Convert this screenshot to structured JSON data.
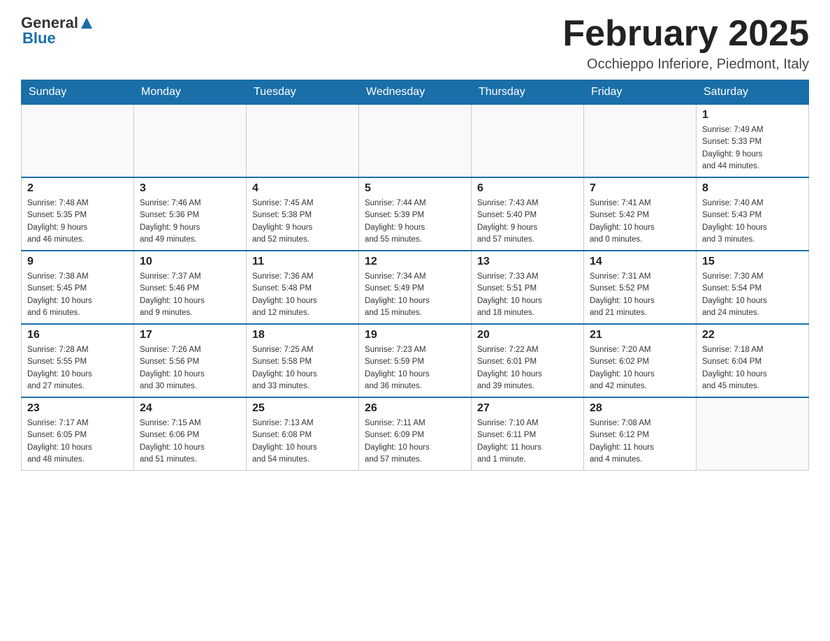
{
  "header": {
    "logo_general": "General",
    "logo_blue": "Blue",
    "month_title": "February 2025",
    "location": "Occhieppo Inferiore, Piedmont, Italy"
  },
  "days_of_week": [
    "Sunday",
    "Monday",
    "Tuesday",
    "Wednesday",
    "Thursday",
    "Friday",
    "Saturday"
  ],
  "weeks": [
    [
      {
        "day": "",
        "info": ""
      },
      {
        "day": "",
        "info": ""
      },
      {
        "day": "",
        "info": ""
      },
      {
        "day": "",
        "info": ""
      },
      {
        "day": "",
        "info": ""
      },
      {
        "day": "",
        "info": ""
      },
      {
        "day": "1",
        "info": "Sunrise: 7:49 AM\nSunset: 5:33 PM\nDaylight: 9 hours\nand 44 minutes."
      }
    ],
    [
      {
        "day": "2",
        "info": "Sunrise: 7:48 AM\nSunset: 5:35 PM\nDaylight: 9 hours\nand 46 minutes."
      },
      {
        "day": "3",
        "info": "Sunrise: 7:46 AM\nSunset: 5:36 PM\nDaylight: 9 hours\nand 49 minutes."
      },
      {
        "day": "4",
        "info": "Sunrise: 7:45 AM\nSunset: 5:38 PM\nDaylight: 9 hours\nand 52 minutes."
      },
      {
        "day": "5",
        "info": "Sunrise: 7:44 AM\nSunset: 5:39 PM\nDaylight: 9 hours\nand 55 minutes."
      },
      {
        "day": "6",
        "info": "Sunrise: 7:43 AM\nSunset: 5:40 PM\nDaylight: 9 hours\nand 57 minutes."
      },
      {
        "day": "7",
        "info": "Sunrise: 7:41 AM\nSunset: 5:42 PM\nDaylight: 10 hours\nand 0 minutes."
      },
      {
        "day": "8",
        "info": "Sunrise: 7:40 AM\nSunset: 5:43 PM\nDaylight: 10 hours\nand 3 minutes."
      }
    ],
    [
      {
        "day": "9",
        "info": "Sunrise: 7:38 AM\nSunset: 5:45 PM\nDaylight: 10 hours\nand 6 minutes."
      },
      {
        "day": "10",
        "info": "Sunrise: 7:37 AM\nSunset: 5:46 PM\nDaylight: 10 hours\nand 9 minutes."
      },
      {
        "day": "11",
        "info": "Sunrise: 7:36 AM\nSunset: 5:48 PM\nDaylight: 10 hours\nand 12 minutes."
      },
      {
        "day": "12",
        "info": "Sunrise: 7:34 AM\nSunset: 5:49 PM\nDaylight: 10 hours\nand 15 minutes."
      },
      {
        "day": "13",
        "info": "Sunrise: 7:33 AM\nSunset: 5:51 PM\nDaylight: 10 hours\nand 18 minutes."
      },
      {
        "day": "14",
        "info": "Sunrise: 7:31 AM\nSunset: 5:52 PM\nDaylight: 10 hours\nand 21 minutes."
      },
      {
        "day": "15",
        "info": "Sunrise: 7:30 AM\nSunset: 5:54 PM\nDaylight: 10 hours\nand 24 minutes."
      }
    ],
    [
      {
        "day": "16",
        "info": "Sunrise: 7:28 AM\nSunset: 5:55 PM\nDaylight: 10 hours\nand 27 minutes."
      },
      {
        "day": "17",
        "info": "Sunrise: 7:26 AM\nSunset: 5:56 PM\nDaylight: 10 hours\nand 30 minutes."
      },
      {
        "day": "18",
        "info": "Sunrise: 7:25 AM\nSunset: 5:58 PM\nDaylight: 10 hours\nand 33 minutes."
      },
      {
        "day": "19",
        "info": "Sunrise: 7:23 AM\nSunset: 5:59 PM\nDaylight: 10 hours\nand 36 minutes."
      },
      {
        "day": "20",
        "info": "Sunrise: 7:22 AM\nSunset: 6:01 PM\nDaylight: 10 hours\nand 39 minutes."
      },
      {
        "day": "21",
        "info": "Sunrise: 7:20 AM\nSunset: 6:02 PM\nDaylight: 10 hours\nand 42 minutes."
      },
      {
        "day": "22",
        "info": "Sunrise: 7:18 AM\nSunset: 6:04 PM\nDaylight: 10 hours\nand 45 minutes."
      }
    ],
    [
      {
        "day": "23",
        "info": "Sunrise: 7:17 AM\nSunset: 6:05 PM\nDaylight: 10 hours\nand 48 minutes."
      },
      {
        "day": "24",
        "info": "Sunrise: 7:15 AM\nSunset: 6:06 PM\nDaylight: 10 hours\nand 51 minutes."
      },
      {
        "day": "25",
        "info": "Sunrise: 7:13 AM\nSunset: 6:08 PM\nDaylight: 10 hours\nand 54 minutes."
      },
      {
        "day": "26",
        "info": "Sunrise: 7:11 AM\nSunset: 6:09 PM\nDaylight: 10 hours\nand 57 minutes."
      },
      {
        "day": "27",
        "info": "Sunrise: 7:10 AM\nSunset: 6:11 PM\nDaylight: 11 hours\nand 1 minute."
      },
      {
        "day": "28",
        "info": "Sunrise: 7:08 AM\nSunset: 6:12 PM\nDaylight: 11 hours\nand 4 minutes."
      },
      {
        "day": "",
        "info": ""
      }
    ]
  ]
}
